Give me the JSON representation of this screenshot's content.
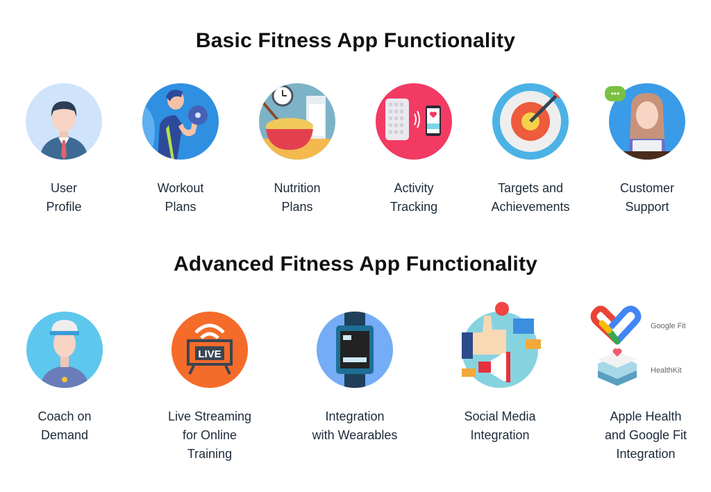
{
  "basic": {
    "title": "Basic Fitness App Functionality",
    "items": [
      {
        "line1": "User",
        "line2": "Profile",
        "icon": "user-profile-icon"
      },
      {
        "line1": "Workout",
        "line2": "Plans",
        "icon": "workout-dumbbell-icon"
      },
      {
        "line1": "Nutrition",
        "line2": "Plans",
        "icon": "nutrition-bowl-icon"
      },
      {
        "line1": "Activity",
        "line2": "Tracking",
        "icon": "activity-tracking-icon"
      },
      {
        "line1": "Targets and",
        "line2": "Achievements",
        "icon": "target-arrow-icon"
      },
      {
        "line1": "Customer",
        "line2": "Support",
        "icon": "customer-support-icon"
      }
    ]
  },
  "advanced": {
    "title": "Advanced Fitness App Functionality",
    "items": [
      {
        "line1": "Coach on",
        "line2": "Demand",
        "line3": "",
        "icon": "coach-icon"
      },
      {
        "line1": "Live Streaming",
        "line2": "for Online",
        "line3": "Training",
        "icon": "live-tv-icon",
        "badge": "LIVE"
      },
      {
        "line1": "Integration",
        "line2": "with Wearables",
        "line3": "",
        "icon": "smartwatch-icon"
      },
      {
        "line1": "Social Media",
        "line2": "Integration",
        "line3": "",
        "icon": "social-media-icon"
      },
      {
        "line1": "Apple Health",
        "line2": "and Google Fit",
        "line3": "Integration",
        "icon": "health-logos-icon",
        "logo1": "Google Fit",
        "logo2": "HealthKit"
      }
    ]
  }
}
